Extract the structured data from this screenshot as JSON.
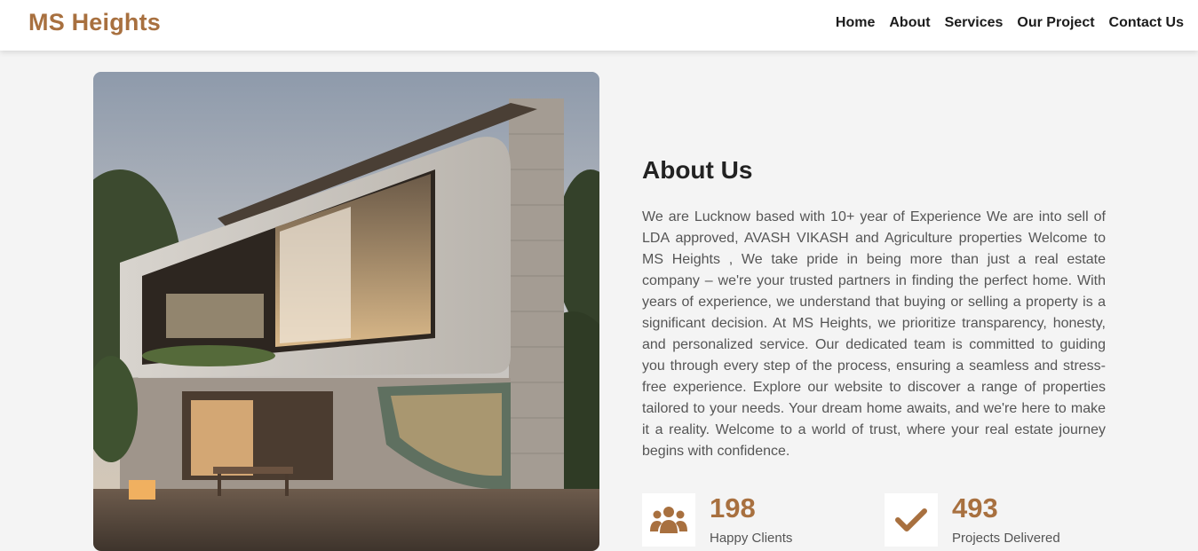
{
  "brand": {
    "name": "MS Heights",
    "color": "#a8703f"
  },
  "nav": {
    "items": [
      {
        "label": "Home"
      },
      {
        "label": "About"
      },
      {
        "label": "Services"
      },
      {
        "label": "Our Project"
      },
      {
        "label": "Contact Us"
      }
    ]
  },
  "about": {
    "title": "About Us",
    "text": "We are Lucknow based with 10+ year of Experience We are into sell of LDA approved, AVASH VIKASH and Agriculture properties Welcome to MS Heights , We take pride in being more than just a real estate company – we're your trusted partners in finding the perfect home. With years of experience, we understand that buying or selling a property is a significant decision. At MS Heights, we prioritize transparency, honesty, and personalized service. Our dedicated team is committed to guiding you through every step of the process, ensuring a seamless and stress-free experience. Explore our website to discover a range of properties tailored to your needs. Your dream home awaits, and we're here to make it a reality. Welcome to a world of trust, where your real estate journey begins with confidence."
  },
  "stats": [
    {
      "number": "198",
      "label": "Happy Clients",
      "icon": "users-icon"
    },
    {
      "number": "493",
      "label": "Projects Delivered",
      "icon": "check-icon"
    }
  ],
  "colors": {
    "accent": "#a8703f",
    "background": "#f4f4f4",
    "text": "#555555"
  }
}
